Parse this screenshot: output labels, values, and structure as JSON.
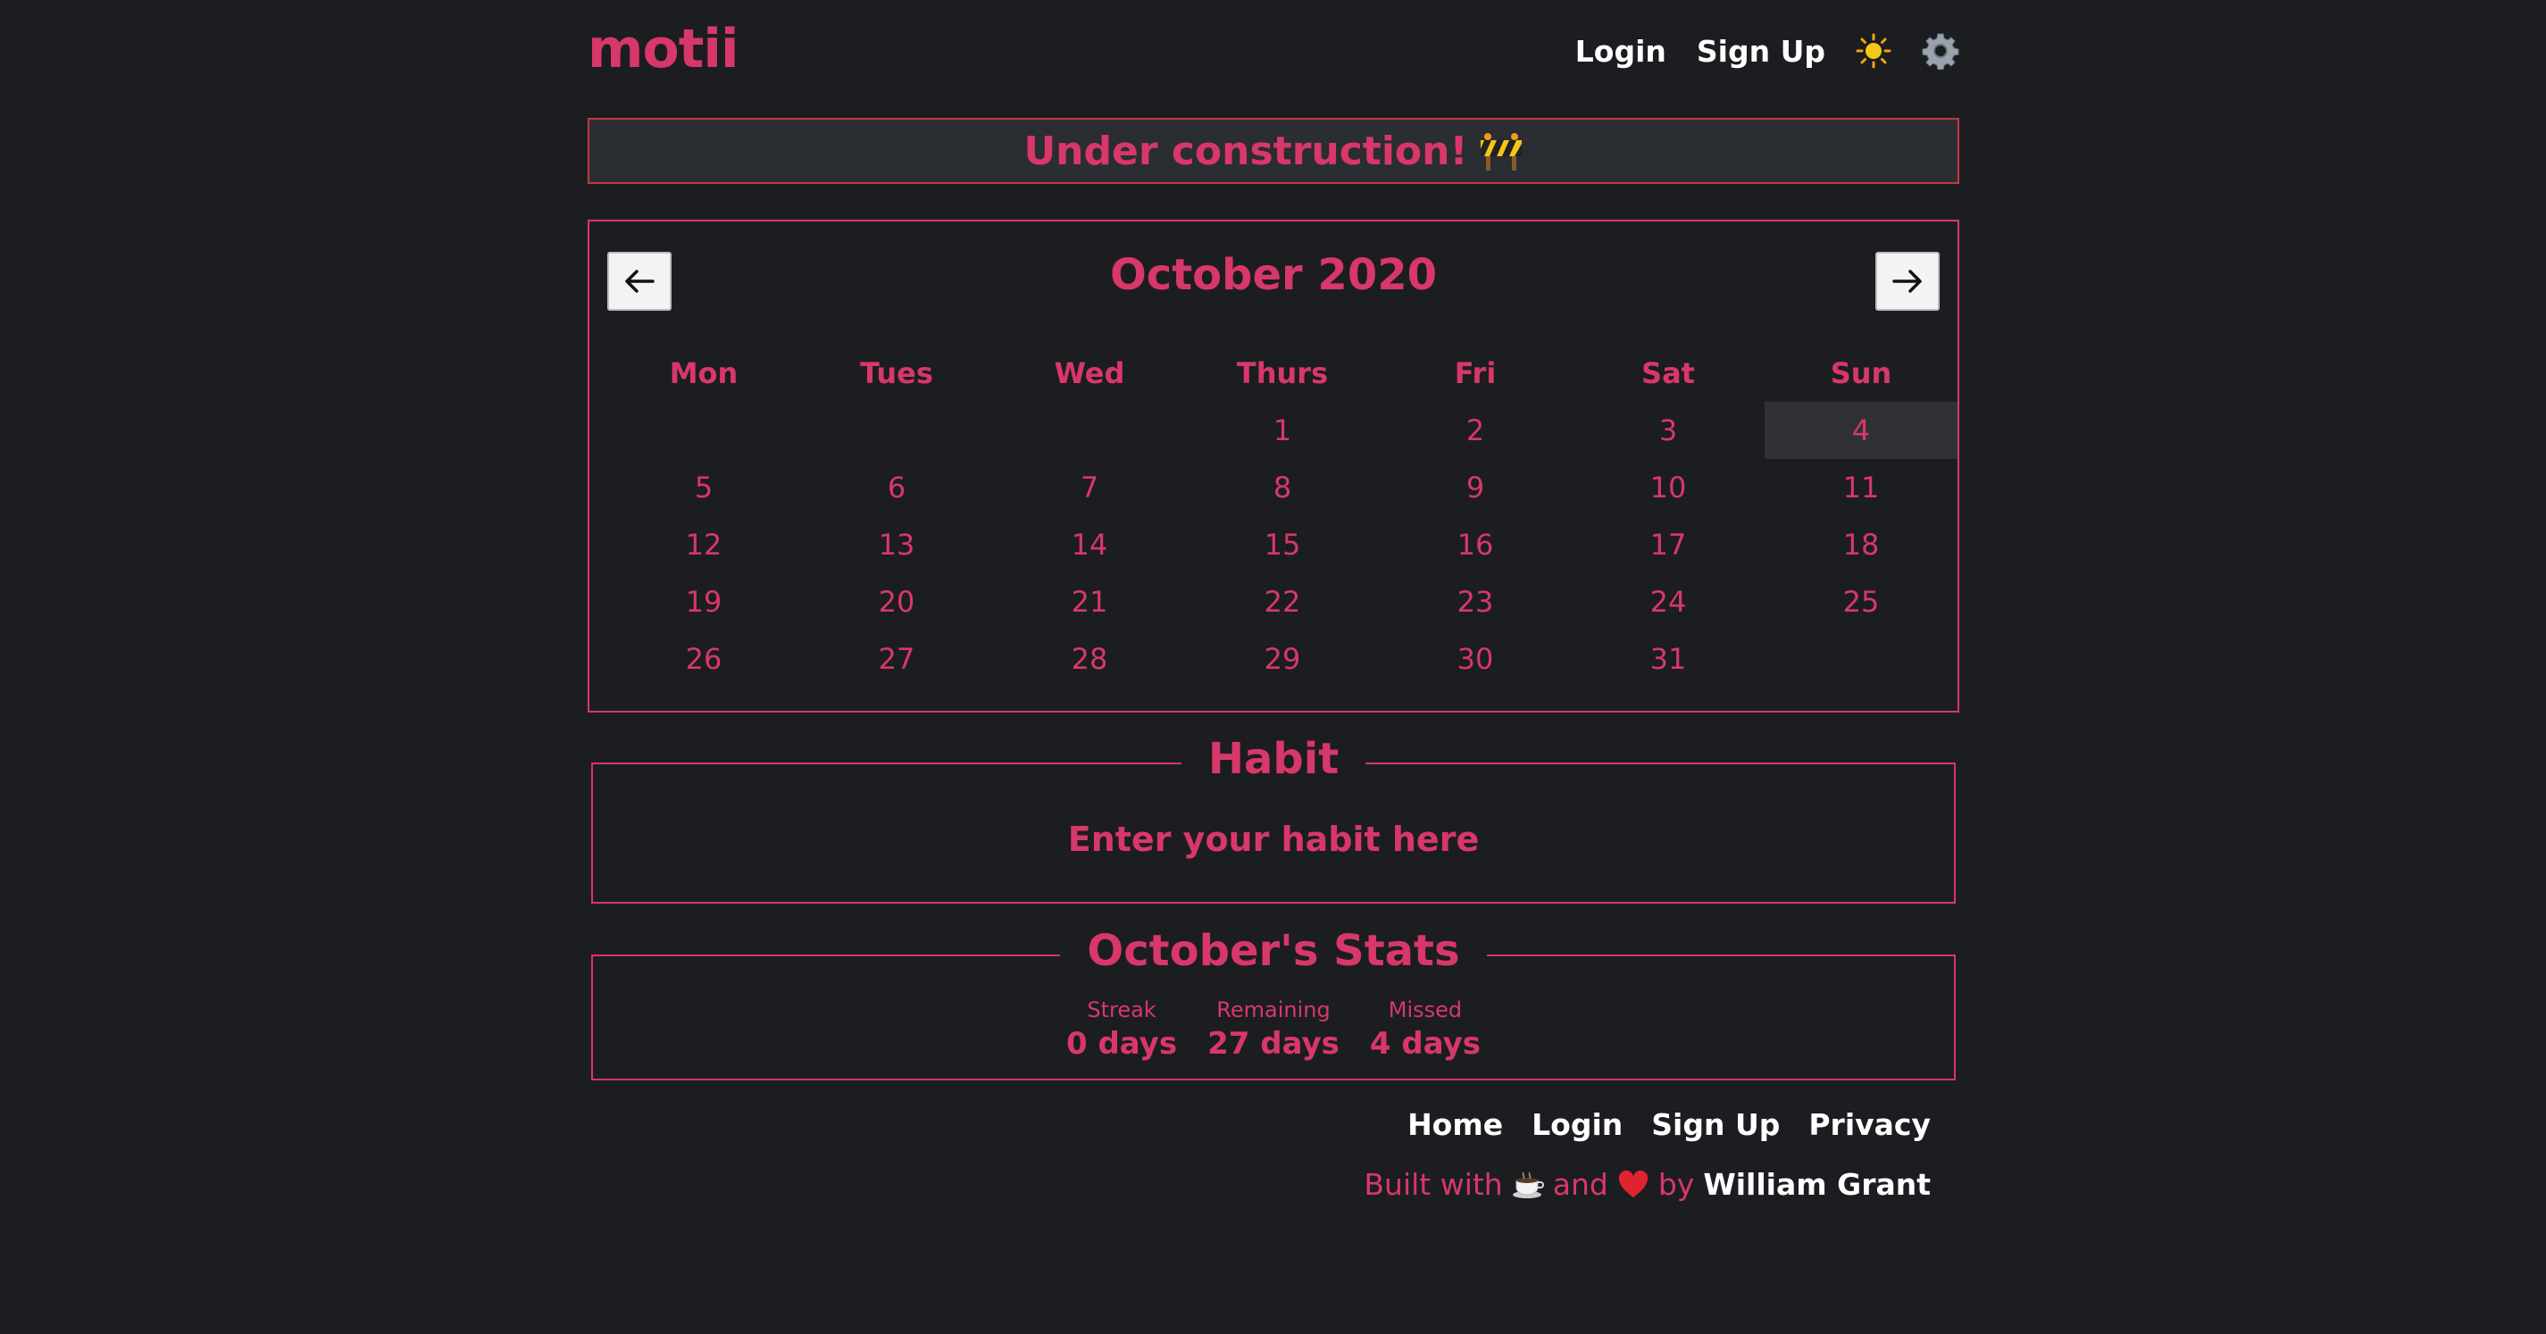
{
  "header": {
    "logo": "motii",
    "nav": {
      "login": "Login",
      "signup": "Sign Up"
    },
    "icons": [
      "sun-icon",
      "gear-icon"
    ]
  },
  "banner": {
    "text": "Under construction!",
    "icon": "construction-barrier-icon"
  },
  "calendar": {
    "title": "October 2020",
    "prev_icon": "arrow-left-icon",
    "next_icon": "arrow-right-icon",
    "weekdays": [
      "Mon",
      "Tues",
      "Wed",
      "Thurs",
      "Fri",
      "Sat",
      "Sun"
    ],
    "weeks": [
      [
        "",
        "",
        "",
        "1",
        "2",
        "3",
        "4"
      ],
      [
        "5",
        "6",
        "7",
        "8",
        "9",
        "10",
        "11"
      ],
      [
        "12",
        "13",
        "14",
        "15",
        "16",
        "17",
        "18"
      ],
      [
        "19",
        "20",
        "21",
        "22",
        "23",
        "24",
        "25"
      ],
      [
        "26",
        "27",
        "28",
        "29",
        "30",
        "31",
        ""
      ]
    ],
    "today": "4"
  },
  "habit": {
    "legend": "Habit",
    "placeholder": "Enter your habit here"
  },
  "stats": {
    "legend": "October's Stats",
    "items": [
      {
        "label": "Streak",
        "value": "0 days"
      },
      {
        "label": "Remaining",
        "value": "27 days"
      },
      {
        "label": "Missed",
        "value": "4 days"
      }
    ]
  },
  "footer": {
    "nav": [
      "Home",
      "Login",
      "Sign Up",
      "Privacy"
    ],
    "credit_prefix": "Built with",
    "credit_and": "and",
    "credit_by": "by",
    "author": "William Grant"
  },
  "colors": {
    "background": "#1b1d21",
    "accent": "#d8376a",
    "banner_bg": "#2a2d32",
    "banner_border": "#c23a3a",
    "today_bg": "#303134"
  }
}
